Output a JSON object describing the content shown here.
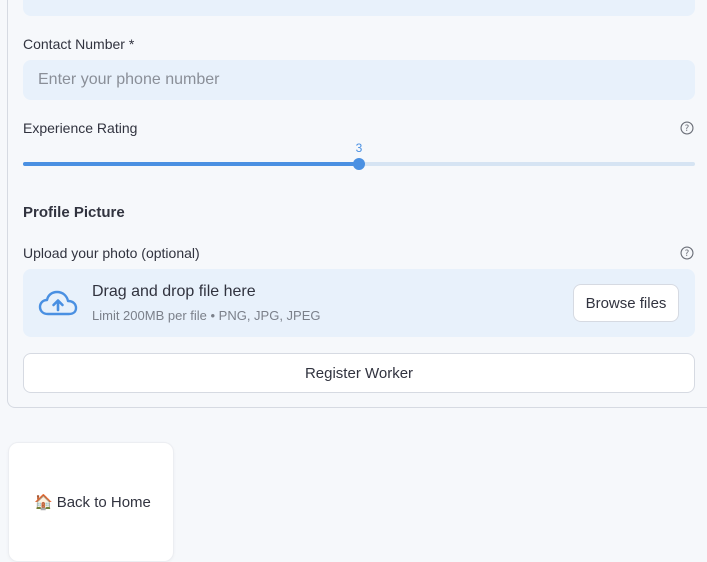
{
  "contact": {
    "label": "Contact Number *",
    "placeholder": "Enter your phone number",
    "value": ""
  },
  "experience": {
    "label": "Experience Rating",
    "value": "3",
    "fraction": 0.5,
    "help_icon": "question-circle-icon"
  },
  "profile": {
    "title": "Profile Picture",
    "upload_label": "Upload your photo (optional)",
    "help_icon": "question-circle-icon",
    "dropzone_title": "Drag and drop file here",
    "dropzone_subtitle": "Limit 200MB per file • PNG, JPG, JPEG",
    "upload_icon": "cloud-upload-icon",
    "browse_label": "Browse files"
  },
  "register_label": "Register Worker",
  "home": {
    "icon": "house-icon",
    "emoji": "🏠",
    "label": "Back to Home"
  },
  "colors": {
    "accent": "#4a90e2",
    "input_background": "#e8f1fb",
    "page_background": "#f6f8fb"
  }
}
